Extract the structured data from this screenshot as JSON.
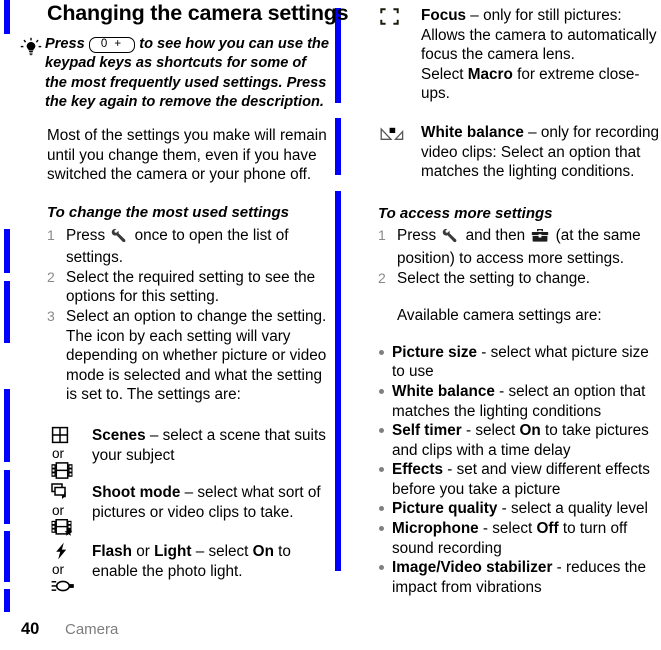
{
  "page": {
    "title": "Changing the camera settings",
    "number": "40",
    "chapter": "Camera",
    "changebar_color": "#0000FF"
  },
  "tip": {
    "icon": "lightbulb-icon",
    "text_before_key": "Press",
    "key_label": "0 +",
    "text_after_key": "to see how you can use the keypad keys as shortcuts for some of the most frequently used settings. Press the key again to remove the description."
  },
  "left": {
    "intro_paragraph": "Most of the settings you make will remain until you change them, even if you have switched the camera or your phone off.",
    "subhead_1": "To change the most used settings",
    "steps": [
      {
        "num": "1",
        "parts": [
          "Press ",
          "[wrench-icon]",
          " once to open the list of settings."
        ],
        "text": "Press   once to open the list of settings."
      },
      {
        "num": "2",
        "text": "Select the required setting to see the options for this setting."
      },
      {
        "num": "3",
        "text": "Select an option to change the setting."
      }
    ],
    "after_steps_paragraph": "The icon by each setting will vary depending on whether picture or video mode is selected and what the setting is set to. The settings are:",
    "or_label": "or",
    "settings_table": [
      {
        "icon_primary": "grid-scenes-icon",
        "icon_secondary": "filmstrip-icon",
        "term": "Scenes",
        "separator": " – ",
        "description": "select a scene that suits your subject"
      },
      {
        "icon_primary": "stacked-photos-icon",
        "icon_secondary": "filmstrip-star-icon",
        "term": "Shoot mode",
        "separator": " – ",
        "description": "select what sort of pictures or video clips to take."
      },
      {
        "icon_primary": "flash-bolt-icon",
        "icon_secondary": "photo-light-icon",
        "term": "Flash",
        "term_joiner": " or ",
        "term2": "Light",
        "separator": " – select ",
        "emphasis": "On",
        "description": " to enable the photo light."
      }
    ]
  },
  "right": {
    "settings_table": [
      {
        "icon": "focus-brackets-icon",
        "term": "Focus",
        "separator": " – ",
        "description": "only for still pictures: Allows the camera to automatically focus the camera lens.",
        "extra_before": "Select ",
        "extra_emphasis": "Macro",
        "extra_after": " for extreme close-ups."
      },
      {
        "icon": "white-balance-icon",
        "term": "White balance",
        "separator": " – ",
        "description": "only for recording video clips: Select an option that matches the lighting conditions."
      }
    ],
    "subhead_1": "To access more settings",
    "steps": [
      {
        "num": "1",
        "text_a": "Press ",
        "icon_a": "wrench-icon",
        "text_b": " and then ",
        "icon_b": "toolbox-icon",
        "text_c": " (at the same position) to access more settings."
      },
      {
        "num": "2",
        "text": "Select the setting to change."
      }
    ],
    "available_intro": "Available camera settings are:",
    "bullets": [
      {
        "term": "Picture size",
        "sep": " - ",
        "text": "select what picture size to use"
      },
      {
        "term": "White balance",
        "sep": " - ",
        "text": "select an option that matches the lighting conditions"
      },
      {
        "term": "Self timer",
        "sep": " - select ",
        "emphasis": "On",
        "text": " to take pictures and clips with a time delay"
      },
      {
        "term": "Effects",
        "sep": " - ",
        "text": "set and view different effects before you take a picture"
      },
      {
        "term": "Picture quality",
        "sep": " - ",
        "text": "select a quality level"
      },
      {
        "term": "Microphone",
        "sep": " - select ",
        "emphasis": "Off",
        "text": " to turn off sound recording"
      },
      {
        "term": "Image/Video stabilizer",
        "sep": " - ",
        "text": "reduces the impact from vibrations"
      }
    ]
  }
}
